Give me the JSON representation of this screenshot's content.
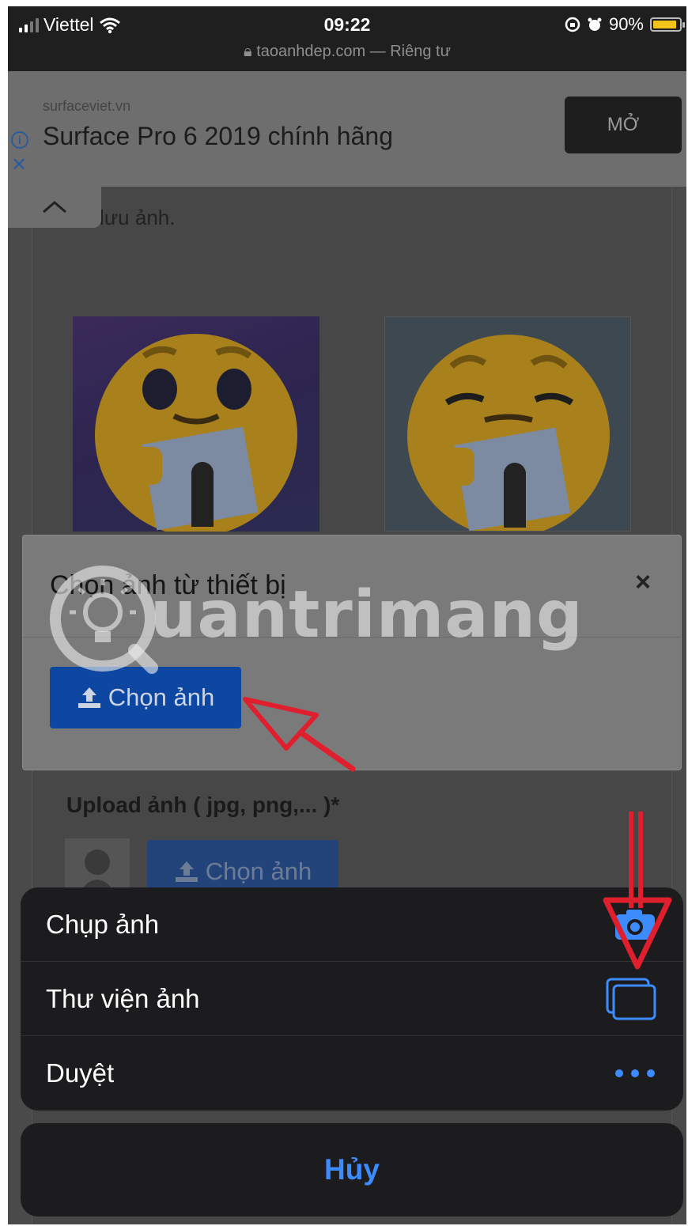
{
  "status_bar": {
    "carrier": "Viettel",
    "time": "09:22",
    "battery": "90%",
    "battery_level": 0.9,
    "url": "taoanhdep.com — Riêng tư"
  },
  "ad": {
    "domain": "surfaceviet.vn",
    "title": "Surface Pro 6 2019 chính hãng",
    "open_label": "MỞ"
  },
  "page": {
    "text_fragment": "lưu ảnh."
  },
  "modal": {
    "title": "Chọn ảnh từ thiết bị",
    "close_label": "×",
    "choose_label": "Chọn ảnh"
  },
  "watermark": {
    "text": "uantrimang"
  },
  "upload": {
    "label": "Upload ảnh ( jpg, png,... )*",
    "choose_label": "Chọn ảnh"
  },
  "action_sheet": {
    "items": [
      {
        "label": "Chụp ảnh",
        "icon": "camera-icon"
      },
      {
        "label": "Thư viện ảnh",
        "icon": "photo-library-icon"
      },
      {
        "label": "Duyệt",
        "icon": "more-icon"
      }
    ],
    "cancel_label": "Hủy"
  },
  "colors": {
    "accent_blue": "#3d8cff",
    "button_blue": "#0d47a1",
    "annotation_red": "#e01f2e",
    "battery_yellow": "#f2c318"
  }
}
